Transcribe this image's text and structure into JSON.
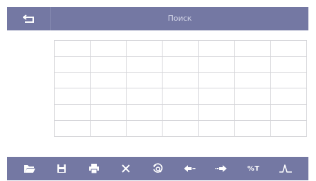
{
  "header": {
    "title": "Поиск",
    "back_icon": "back-arrow-icon"
  },
  "grid": {
    "rows": 6,
    "columns": 7,
    "cells": [
      [
        "",
        "",
        "",
        "",
        "",
        "",
        ""
      ],
      [
        "",
        "",
        "",
        "",
        "",
        "",
        ""
      ],
      [
        "",
        "",
        "",
        "",
        "",
        "",
        ""
      ],
      [
        "",
        "",
        "",
        "",
        "",
        "",
        ""
      ],
      [
        "",
        "",
        "",
        "",
        "",
        "",
        ""
      ],
      [
        "",
        "",
        "",
        "",
        "",
        "",
        ""
      ]
    ]
  },
  "toolbar": {
    "buttons": [
      {
        "icon": "folder-open-icon"
      },
      {
        "icon": "save-icon"
      },
      {
        "icon": "print-icon"
      },
      {
        "icon": "close-icon"
      },
      {
        "icon": "search-clock-icon"
      },
      {
        "icon": "arrow-left-icon"
      },
      {
        "icon": "arrow-right-icon"
      },
      {
        "icon": "percent-t-icon",
        "label": "%T"
      },
      {
        "icon": "peak-signal-icon"
      }
    ]
  },
  "colors": {
    "bar": "#7478a3",
    "title_text": "#cfd1e4",
    "grid_line": "#d4d4d8",
    "icon": "#ffffff"
  }
}
